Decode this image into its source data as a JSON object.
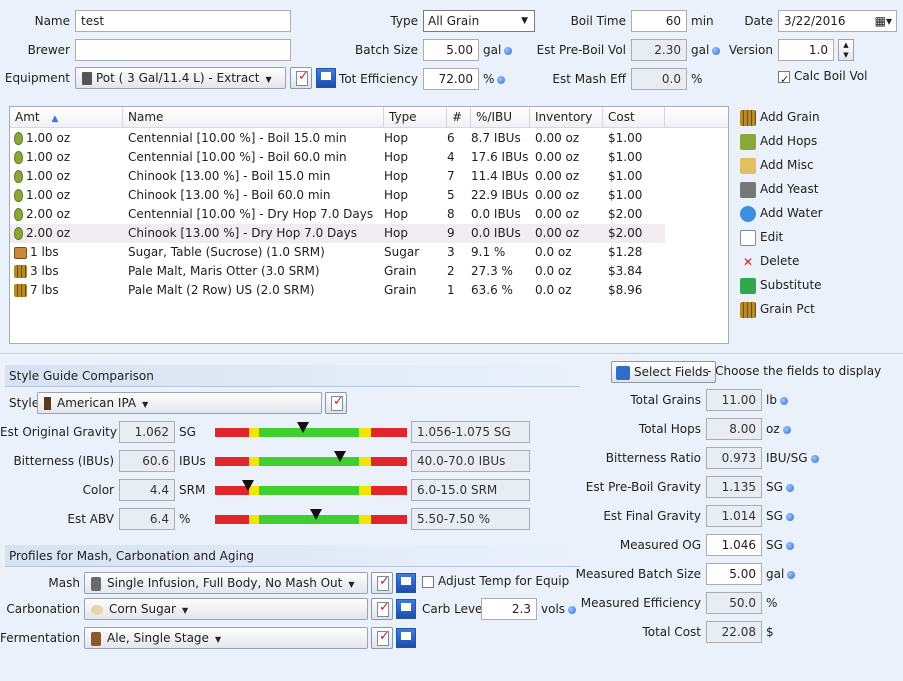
{
  "header": {
    "name_label": "Name",
    "name_value": "test",
    "brewer_label": "Brewer",
    "brewer_value": "",
    "equipment_label": "Equipment",
    "equipment_value": "Pot ( 3 Gal/11.4 L) - Extract",
    "type_label": "Type",
    "type_value": "All Grain",
    "batch_size_label": "Batch Size",
    "batch_size_value": "5.00",
    "batch_size_unit": "gal",
    "tot_eff_label": "Tot Efficiency",
    "tot_eff_value": "72.00",
    "tot_eff_unit": "%",
    "boil_time_label": "Boil Time",
    "boil_time_value": "60",
    "boil_time_unit": "min",
    "pre_boil_label": "Est Pre-Boil Vol",
    "pre_boil_value": "2.30",
    "pre_boil_unit": "gal",
    "mash_eff_label": "Est Mash Eff",
    "mash_eff_value": "0.0",
    "mash_eff_unit": "%",
    "date_label": "Date",
    "date_value": "3/22/2016",
    "version_label": "Version",
    "version_value": "1.0",
    "calc_boil_label": "Calc Boil Vol"
  },
  "ingredients": {
    "columns": [
      "Amt",
      "Name",
      "Type",
      "#",
      "%/IBU",
      "Inventory",
      "Cost"
    ],
    "rows": [
      {
        "icon": "hop",
        "amt": "1.00 oz",
        "name": "Centennial [10.00 %] - Boil 15.0 min",
        "type": "Hop",
        "num": "6",
        "pct": "8.7 IBUs",
        "inv": "0.00 oz",
        "cost": "$1.00"
      },
      {
        "icon": "hop",
        "amt": "1.00 oz",
        "name": "Centennial [10.00 %] - Boil 60.0 min",
        "type": "Hop",
        "num": "4",
        "pct": "17.6 IBUs",
        "inv": "0.00 oz",
        "cost": "$1.00"
      },
      {
        "icon": "hop",
        "amt": "1.00 oz",
        "name": "Chinook [13.00 %] - Boil 15.0 min",
        "type": "Hop",
        "num": "7",
        "pct": "11.4 IBUs",
        "inv": "0.00 oz",
        "cost": "$1.00"
      },
      {
        "icon": "hop",
        "amt": "1.00 oz",
        "name": "Chinook [13.00 %] - Boil 60.0 min",
        "type": "Hop",
        "num": "5",
        "pct": "22.9 IBUs",
        "inv": "0.00 oz",
        "cost": "$1.00"
      },
      {
        "icon": "hop",
        "amt": "2.00 oz",
        "name": "Centennial [10.00 %] - Dry Hop 7.0 Days",
        "type": "Hop",
        "num": "8",
        "pct": "0.0 IBUs",
        "inv": "0.00 oz",
        "cost": "$2.00"
      },
      {
        "icon": "hop",
        "amt": "2.00 oz",
        "name": "Chinook [13.00 %] - Dry Hop 7.0 Days",
        "type": "Hop",
        "num": "9",
        "pct": "0.0 IBUs",
        "inv": "0.00 oz",
        "cost": "$2.00"
      },
      {
        "icon": "sugar",
        "amt": "1 lbs",
        "name": "Sugar, Table (Sucrose) (1.0 SRM)",
        "type": "Sugar",
        "num": "3",
        "pct": "9.1 %",
        "inv": "0.0 oz",
        "cost": "$1.28"
      },
      {
        "icon": "grain",
        "amt": "3 lbs",
        "name": "Pale Malt, Maris Otter (3.0 SRM)",
        "type": "Grain",
        "num": "2",
        "pct": "27.3 %",
        "inv": "0.0 oz",
        "cost": "$3.84"
      },
      {
        "icon": "grain",
        "amt": "7 lbs",
        "name": "Pale Malt (2 Row) US (2.0 SRM)",
        "type": "Grain",
        "num": "1",
        "pct": "63.6 %",
        "inv": "0.0 oz",
        "cost": "$8.96"
      }
    ]
  },
  "actions": [
    "Add Grain",
    "Add Hops",
    "Add Misc",
    "Add Yeast",
    "Add Water",
    "Edit",
    "Delete",
    "Substitute",
    "Grain Pct"
  ],
  "style_section": {
    "title": "Style Guide Comparison",
    "style_label": "Style",
    "style_value": "American IPA",
    "rows": [
      {
        "label": "Est Original Gravity",
        "value": "1.062",
        "unit": "SG",
        "range": "1.056-1.075 SG",
        "marker": 0.48
      },
      {
        "label": "Bitterness (IBUs)",
        "value": "60.6",
        "unit": "IBUs",
        "range": "40.0-70.0 IBUs",
        "marker": 0.68
      },
      {
        "label": "Color",
        "value": "4.4",
        "unit": "SRM",
        "range": "6.0-15.0 SRM",
        "marker": 0.18
      },
      {
        "label": "Est ABV",
        "value": "6.4",
        "unit": "%",
        "range": "5.50-7.50 %",
        "marker": 0.55
      }
    ]
  },
  "profiles": {
    "title": "Profiles for Mash, Carbonation and Aging",
    "mash_label": "Mash",
    "mash_value": "Single Infusion, Full Body, No Mash Out",
    "adjust_label": "Adjust Temp for Equip",
    "carb_label": "Carbonation",
    "carb_value": "Corn Sugar",
    "carb_level_label": "Carb Level",
    "carb_level_value": "2.3",
    "carb_level_unit": "vols",
    "ferm_label": "Fermentation",
    "ferm_value": "Ale, Single Stage"
  },
  "stats": {
    "select_fields_label": "Select Fields",
    "select_hint": "- Choose the fields to display",
    "rows": [
      {
        "label": "Total Grains",
        "value": "11.00",
        "unit": "lb",
        "dot": true,
        "editable": false
      },
      {
        "label": "Total Hops",
        "value": "8.00",
        "unit": "oz",
        "dot": true,
        "editable": false
      },
      {
        "label": "Bitterness Ratio",
        "value": "0.973",
        "unit": "IBU/SG",
        "dot": true,
        "editable": false
      },
      {
        "label": "Est Pre-Boil Gravity",
        "value": "1.135",
        "unit": "SG",
        "dot": true,
        "editable": false
      },
      {
        "label": "Est Final Gravity",
        "value": "1.014",
        "unit": "SG",
        "dot": true,
        "editable": false
      },
      {
        "label": "Measured OG",
        "value": "1.046",
        "unit": "SG",
        "dot": true,
        "editable": true
      },
      {
        "label": "Measured Batch Size",
        "value": "5.00",
        "unit": "gal",
        "dot": true,
        "editable": true
      },
      {
        "label": "Measured Efficiency",
        "value": "50.0",
        "unit": "%",
        "dot": false,
        "editable": false
      },
      {
        "label": "Total Cost",
        "value": "22.08",
        "unit": "$",
        "dot": false,
        "editable": false
      }
    ]
  },
  "colors": {
    "accent": "#2b6fd6",
    "bar_red": "#e0262b",
    "bar_yellow": "#f2e600",
    "bar_green": "#3fcf2f"
  }
}
